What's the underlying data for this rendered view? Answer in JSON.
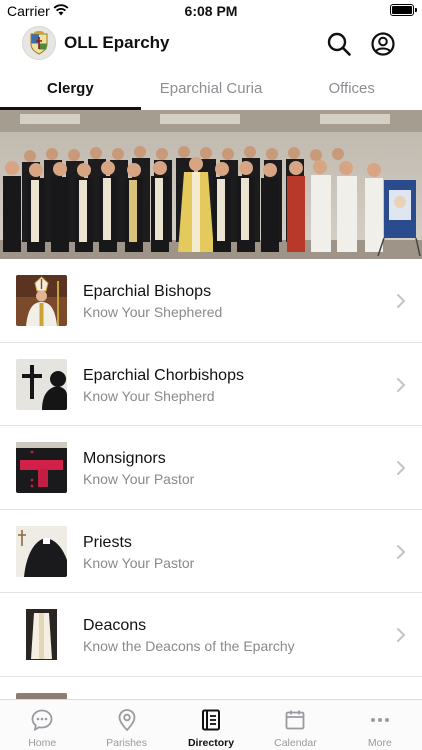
{
  "status_bar": {
    "carrier": "Carrier",
    "time": "6:08 PM"
  },
  "header": {
    "title": "OLL Eparchy",
    "logo_icon": "eparchy-crest-icon",
    "search_icon": "search-icon",
    "account_icon": "account-circle-icon"
  },
  "tabs": [
    {
      "label": "Clergy",
      "active": true
    },
    {
      "label": "Eparchial Curia",
      "active": false
    },
    {
      "label": "Offices",
      "active": false
    }
  ],
  "list": {
    "items": [
      {
        "title": "Eparchial Bishops",
        "subtitle": "Know Your Shephered",
        "thumb_icon": "bishop-photo"
      },
      {
        "title": "Eparchial Chorbishops",
        "subtitle": "Know Your Shepherd",
        "thumb_icon": "cross-silhouette-photo"
      },
      {
        "title": "Monsignors",
        "subtitle": "Know Your Pastor",
        "thumb_icon": "monsignor-sash-photo"
      },
      {
        "title": "Priests",
        "subtitle": "Know Your Pastor",
        "thumb_icon": "priest-collar-photo"
      },
      {
        "title": "Deacons",
        "subtitle": "Know the Deacons of the Eparchy",
        "thumb_icon": "deacon-vestment-photo"
      }
    ]
  },
  "tabbar": {
    "items": [
      {
        "label": "Home",
        "icon": "chat-bubble-icon",
        "active": false
      },
      {
        "label": "Parishes",
        "icon": "location-pin-icon",
        "active": false
      },
      {
        "label": "Directory",
        "icon": "directory-book-icon",
        "active": true
      },
      {
        "label": "Calendar",
        "icon": "calendar-icon",
        "active": false
      },
      {
        "label": "More",
        "icon": "more-dots-icon",
        "active": false
      }
    ]
  },
  "colors": {
    "accent": "#111111",
    "inactive": "#8e8e93",
    "divider": "#e3e3e6"
  }
}
